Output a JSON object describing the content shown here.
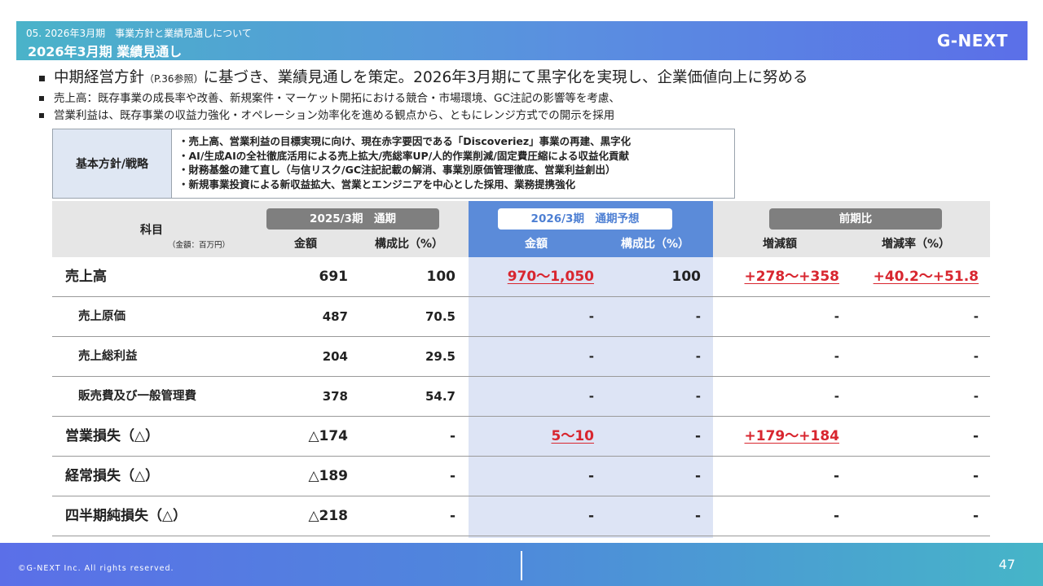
{
  "header": {
    "section": "05.  2026年3月期　事業方針と業績見通しについて",
    "title": "2026年3月期 業績見通し",
    "logo": "G-NEXT"
  },
  "bullets": {
    "main_pre": "中期経営方針",
    "main_ref": "（P.36参照）",
    "main_post": "に基づき、業績見通しを策定。2026年3月期にて黒字化を実現し、企業価値向上に努める",
    "line2": "売上高：既存事業の成長率や改善、新規案件・マーケット開拓における競合・市場環境、GC注記の影響等を考慮、",
    "line3": "営業利益は、既存事業の収益力強化・オペレーション効率化を進める観点から、ともにレンジ方式での開示を採用"
  },
  "policy": {
    "label": "基本方針/戦略",
    "items": [
      "・売上高、営業利益の目標実現に向け、現在赤字要因である「Discoveriez」事業の再建、黒字化",
      "・AI/生成AIの全社徹底活用による売上拡大/売総率UP/人的作業削減/固定費圧縮による収益化貢献",
      "・財務基盤の建て直し（与信リスク/GC注記記載の解消、事業別原価管理徹底、営業利益創出）",
      "・新規事業投資による新収益拡大、営業とエンジニアを中心とした採用、業務提携強化"
    ]
  },
  "table": {
    "subject": "科目",
    "unit": "（金額：百万円）",
    "group1": "2025/3期　通期",
    "group2": "2026/3期　通期予想",
    "group3": "前期比",
    "col_amount": "金額",
    "col_ratio": "構成比（%）",
    "col_change": "増減額",
    "col_change_rate": "増減率（%）",
    "rows": [
      {
        "label": "売上高",
        "v1": "691",
        "v2": "100",
        "v3": "970～1,050",
        "v4": "100",
        "v5": "+278～+358",
        "v6": "+40.2～+51.8"
      },
      {
        "label": "売上原価",
        "v1": "487",
        "v2": "70.5",
        "v3": "-",
        "v4": "-",
        "v5": "-",
        "v6": "-"
      },
      {
        "label": "売上総利益",
        "v1": "204",
        "v2": "29.5",
        "v3": "-",
        "v4": "-",
        "v5": "-",
        "v6": "-"
      },
      {
        "label": "販売費及び一般管理費",
        "v1": "378",
        "v2": "54.7",
        "v3": "-",
        "v4": "-",
        "v5": "-",
        "v6": "-"
      },
      {
        "label": "営業損失（△）",
        "v1": "△174",
        "v2": "-",
        "v3": "5～10",
        "v4": "-",
        "v5": "+179～+184",
        "v6": "-"
      },
      {
        "label": "経常損失（△）",
        "v1": "△189",
        "v2": "-",
        "v3": "-",
        "v4": "-",
        "v5": "-",
        "v6": "-"
      },
      {
        "label": "四半期純損失（△）",
        "v1": "△218",
        "v2": "-",
        "v3": "-",
        "v4": "-",
        "v5": "-",
        "v6": "-"
      }
    ]
  },
  "footer": {
    "copyright": "©G-NEXT Inc. All rights reserved.",
    "page": "47"
  },
  "colors": {
    "accent_blue": "#5b8bd9",
    "highlight_column": "#dde4f5",
    "red": "#d8262f",
    "gray_pill": "#7f7f7f"
  }
}
